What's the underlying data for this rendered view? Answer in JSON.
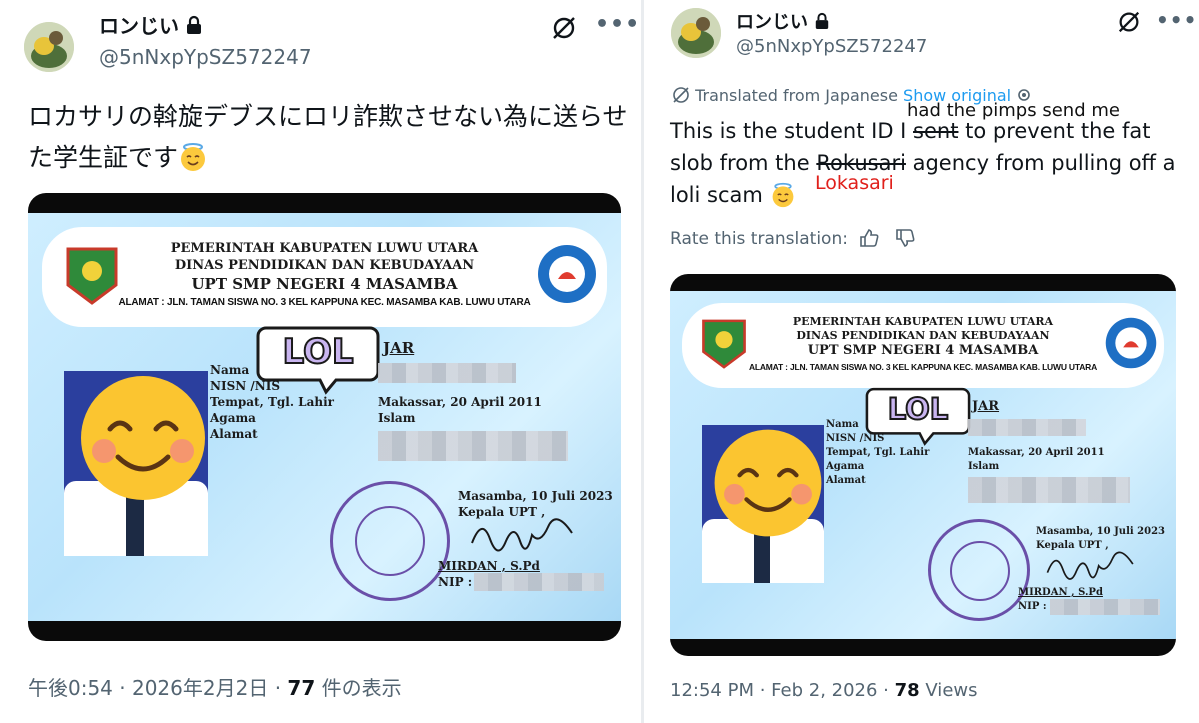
{
  "left": {
    "username": "ロンじい",
    "handle": "@5nNxpYpSZ572247",
    "tweet_text": "ロカサリの斡旋デブスにロリ詐欺させない為に送らせた学生証です",
    "timestamp": "午後0:54 · 2026年2月2日 · ",
    "views_count": "77",
    "views_label": " 件の表示"
  },
  "right": {
    "username": "ロンじい",
    "handle": "@5nNxpYpSZ572247",
    "translated_from": "Translated from Japanese",
    "show_original": "Show original",
    "tweet_part1": "This is the student ID I ",
    "tweet_strike1": "sent",
    "tweet_part2": " to prevent the fat slob from the ",
    "tweet_strike2": "Rokusari",
    "tweet_part3": " agency from pulling off a loli scam",
    "annotation_top": "had the pimps send me",
    "annotation_red": "Lokasari",
    "rate_label": "Rate this translation:",
    "timestamp": "12:54 PM · Feb 2, 2026 · ",
    "views_count": "78",
    "views_label": " Views"
  },
  "card": {
    "line1": "PEMERINTAH KABUPATEN LUWU UTARA",
    "line2": "DINAS PENDIDIKAN DAN KEBUDAYAAN",
    "line3": "UPT SMP NEGERI 4 MASAMBA",
    "address": "ALAMAT : JLN. TAMAN SISWA NO. 3 KEL KAPPUNA KEC. MASAMBA KAB. LUWU UTARA",
    "sticker": "LOL",
    "name_suffix": "JAR",
    "labels": [
      "Nama",
      "NISN /NIS",
      "Tempat, Tgl. Lahir",
      "Agama",
      "Alamat"
    ],
    "birth": "Makassar, 20 April 2011",
    "religion": "Islam",
    "date": "Masamba, 10 Juli 2023",
    "kepala": "Kepala UPT ,",
    "signer": "MIRDAN , S.Pd",
    "nip": "NIP :",
    "stamp_text": "PEMERINTAH KABUPATEN LUWU UTARA · UPT SMP NEGERI 4 MASAMBA · DINAS PENDIDIKAN DAN KEBUDAYAAN"
  },
  "colors": {
    "accent": "#1d9bf0",
    "muted": "#536471",
    "annotation": "#e0201b"
  }
}
